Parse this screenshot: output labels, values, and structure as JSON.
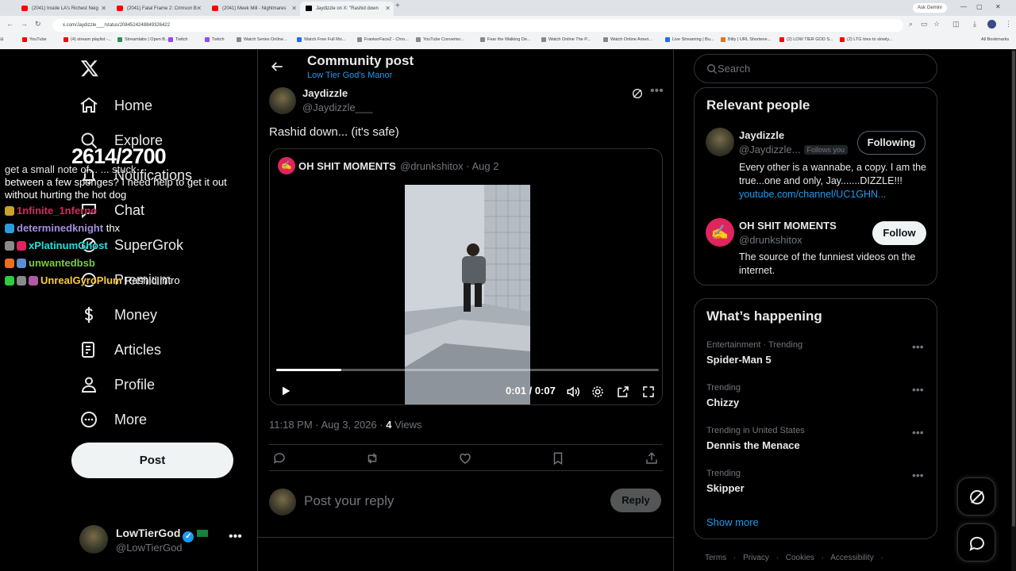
{
  "browser": {
    "tabs": [
      {
        "label": "(2041) Inside LA's Richest Neig",
        "icon": "youtube-icon"
      },
      {
        "label": "(2041) Fatal Frame 2: Crimson B",
        "icon": "youtube-icon"
      },
      {
        "label": "(2041) Meek Mill - Nightmares",
        "icon": "youtube-icon"
      },
      {
        "label": "Jaydizzle on X: \"Rashid down",
        "icon": "x-icon",
        "active": true
      }
    ],
    "new_tab": "+",
    "ask_gemini": "Ask Gemini",
    "url": "x.com/Jaydizzle___/status/2084524248849326422",
    "bookmarks": [
      {
        "label": "YouTube",
        "color": "#ff0000"
      },
      {
        "label": "(4) stream playlist -...",
        "color": "#ff0000"
      },
      {
        "label": "Streamlabs | Open B...",
        "color": "#2e8b57"
      },
      {
        "label": "Twitch",
        "color": "#9146ff"
      },
      {
        "label": "Twitch",
        "color": "#9146ff"
      },
      {
        "label": "Watch Series Online...",
        "color": "#888888"
      },
      {
        "label": "Watch Free Full Mo...",
        "color": "#1f6feb"
      },
      {
        "label": "FrankerFaceZ - Chro...",
        "color": "#888888"
      },
      {
        "label": "YouTube Converter...",
        "color": "#888888"
      },
      {
        "label": "Fear the Walking De...",
        "color": "#888888"
      },
      {
        "label": "Watch Online The P...",
        "color": "#888888"
      },
      {
        "label": "Watch Online Ameri...",
        "color": "#888888"
      },
      {
        "label": "Live Streaming | Bu...",
        "color": "#1f6feb"
      },
      {
        "label": "Bitly | URL Shortene...",
        "color": "#e8711a"
      },
      {
        "label": "(2) LOW TIER GOD S...",
        "color": "#ff0000"
      },
      {
        "label": "(2) LTG tries to slowly...",
        "color": "#ff0000"
      }
    ],
    "all_bookmarks": "All Bookmarks"
  },
  "nav": {
    "items": [
      {
        "label": "Home",
        "icon": "home-icon"
      },
      {
        "label": "Explore",
        "icon": "search-icon"
      },
      {
        "label": "Notifications",
        "icon": "bell-icon"
      },
      {
        "label": "Chat",
        "icon": "chat-icon"
      },
      {
        "label": "SuperGrok",
        "icon": "grok-icon"
      },
      {
        "label": "Premium",
        "icon": "premium-icon"
      },
      {
        "label": "Money",
        "icon": "dollar-icon"
      },
      {
        "label": "Articles",
        "icon": "article-icon"
      },
      {
        "label": "Profile",
        "icon": "person-icon"
      },
      {
        "label": "More",
        "icon": "more-circle-icon"
      }
    ],
    "post_button": "Post",
    "account": {
      "name": "LowTierGod",
      "handle": "@LowTierGod"
    }
  },
  "stream_overlay": {
    "counter": "2614/2700",
    "message_lines": [
      "get a small note of... ... stuck",
      "between a few sponges? I need help to get it out",
      "without hurting the hot dog"
    ],
    "chat": [
      {
        "user": "1nfinite_1nferno",
        "text": "",
        "color": "#e0245e"
      },
      {
        "user": "determinedknight",
        "text": "thx",
        "color": "#a58ee0"
      },
      {
        "user": "xPlatinumGhost",
        "text": "",
        "color": "#22e0e0"
      },
      {
        "user": "unwantedbsb",
        "text": "",
        "color": "#7ac943"
      },
      {
        "user": "UnrealGyroPlum",
        "text": "Rashid intro",
        "color": "#ffcc33"
      }
    ]
  },
  "header": {
    "title": "Community post",
    "community": "Low Tier God's Manor"
  },
  "post": {
    "author_name": "Jaydizzle",
    "author_handle": "@Jaydizzle___",
    "text": "Rashid down... (it's safe)",
    "timestamp": "11:18 PM · Aug 3, 2026 ·",
    "views_count": "4",
    "views_label": "Views",
    "quote": {
      "name": "OH SHIT MOMENTS",
      "handle": "@drunkshitox · Aug 2",
      "video": {
        "time": "0:01 / 0:07",
        "progress_fraction": 0.17
      }
    }
  },
  "reply": {
    "placeholder": "Post your reply",
    "button": "Reply"
  },
  "search": {
    "placeholder": "Search"
  },
  "relevant": {
    "title": "Relevant people",
    "people": [
      {
        "name": "Jaydizzle",
        "handle": "@Jaydizzle...",
        "follows_you": "Follows you",
        "bio": "Every other is a wannabe, a copy. I am the true...one and only, Jay.......DIZZLE!!!",
        "link": "youtube.com/channel/UC1GHN...",
        "button": "Following"
      },
      {
        "name": "OH SHIT MOMENTS",
        "handle": "@drunkshitox",
        "bio": "The source of the funniest videos on the internet.",
        "button": "Follow"
      }
    ]
  },
  "happening": {
    "title": "What’s happening",
    "trends": [
      {
        "context": "Entertainment · Trending",
        "name": "Spider-Man 5"
      },
      {
        "context": "Trending",
        "name": "Chizzy"
      },
      {
        "context": "Trending in United States",
        "name": "Dennis the Menace"
      },
      {
        "context": "Trending",
        "name": "Skipper"
      }
    ],
    "show_more": "Show more"
  },
  "footer": {
    "text": "Terms · Privacy · Cookies · Accessibility ·"
  }
}
